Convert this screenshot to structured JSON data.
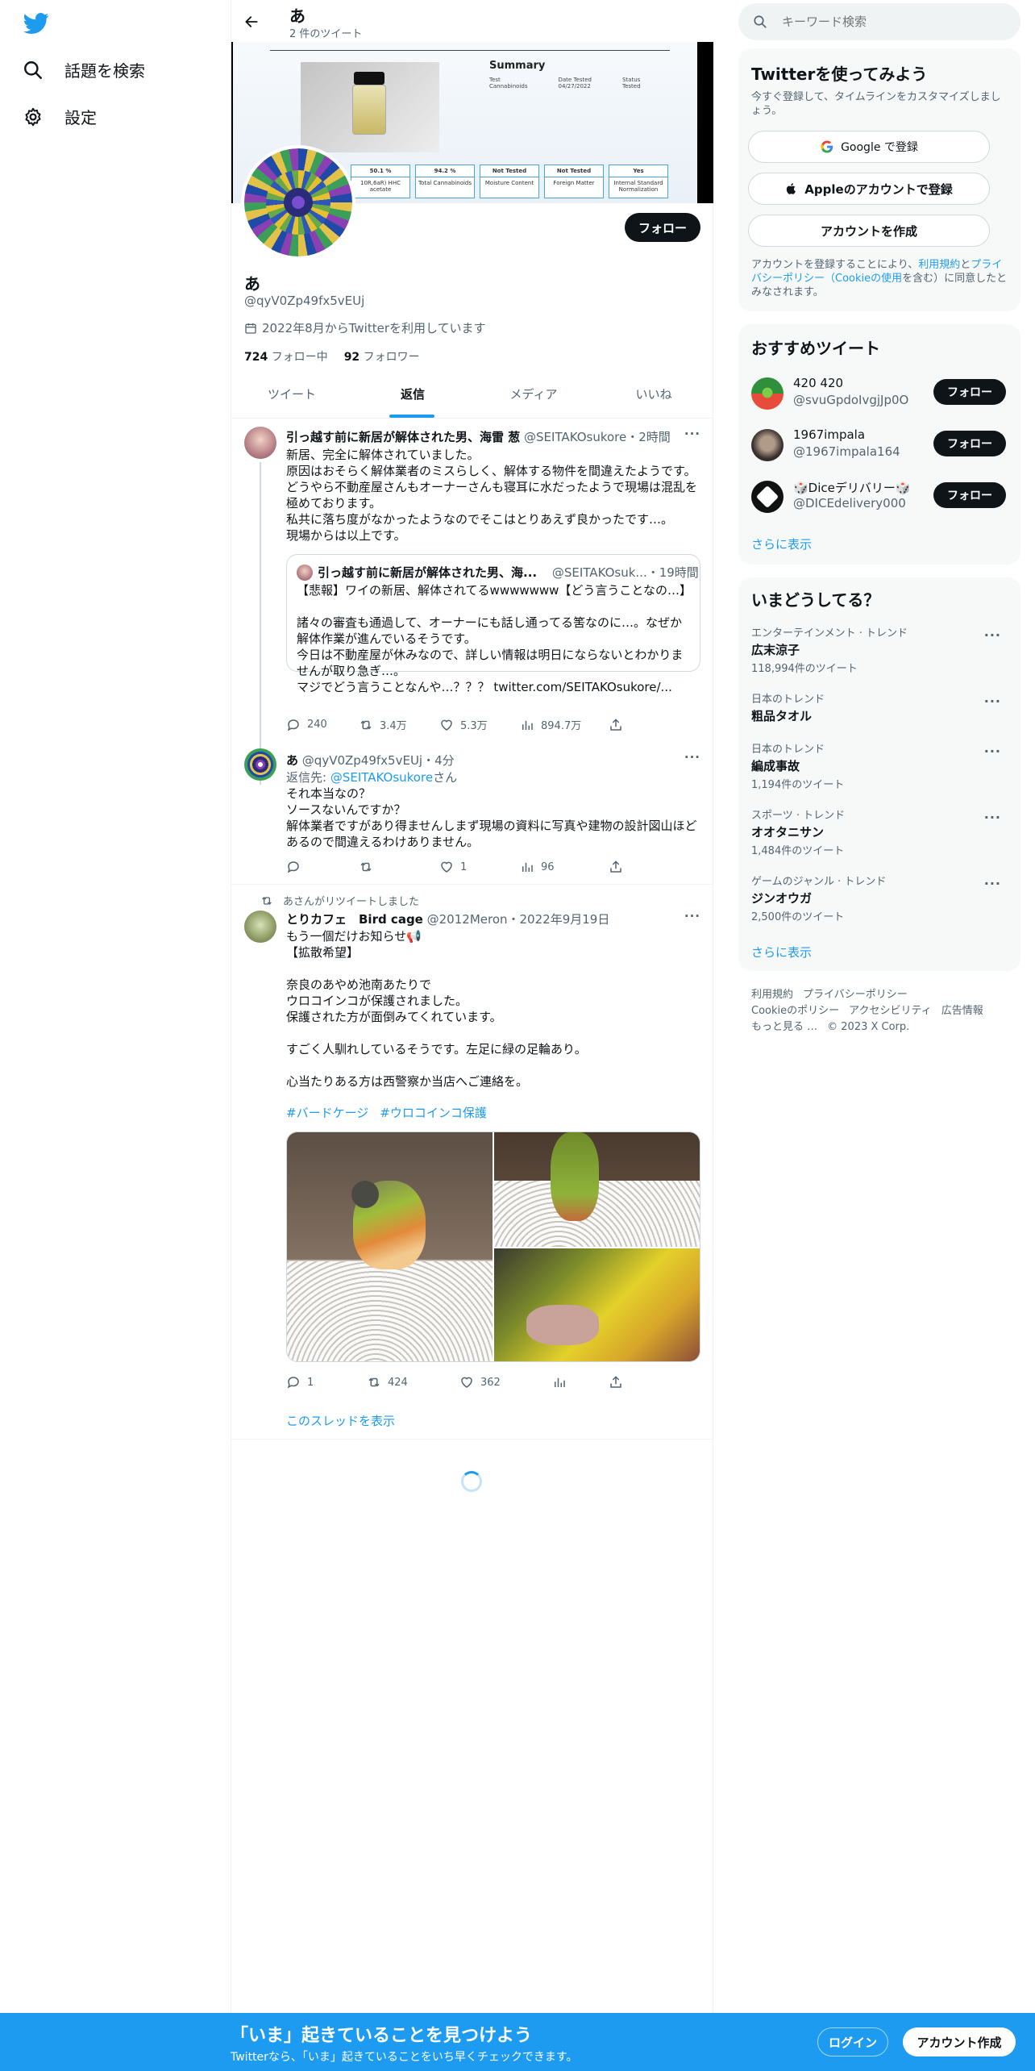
{
  "nav": {
    "explore_label": "話題を検索",
    "settings_label": "設定"
  },
  "header": {
    "title": "あ",
    "tweet_count": "2 件のツイート"
  },
  "banner": {
    "summary_title": "Summary",
    "summary_test_label": "Test",
    "summary_test_value": "Cannabinoids",
    "summary_date_label": "Date Tested",
    "summary_date_value": "04/27/2022",
    "summary_status_label": "Status",
    "summary_status_value": "Tested",
    "cells": [
      {
        "value": "50.1 %",
        "label": "10R,6aR) HHC acetate"
      },
      {
        "value": "94.2 %",
        "label": "Total Cannabinoids"
      },
      {
        "value": "Not Tested",
        "label": "Moisture Content"
      },
      {
        "value": "Not Tested",
        "label": "Foreign Matter"
      },
      {
        "value": "Yes",
        "label": "Internal Standard Normalization"
      }
    ]
  },
  "profile": {
    "name": "あ",
    "handle": "@qyV0Zp49fx5vEUj",
    "joined": "2022年8月からTwitterを利用しています",
    "following_count": "724",
    "following_label": "フォロー中",
    "followers_count": "92",
    "followers_label": "フォロワー",
    "follow_label": "フォロー"
  },
  "tabs": [
    "ツイート",
    "返信",
    "メディア",
    "いいね"
  ],
  "tweets": {
    "t1": {
      "author": "引っ越す前に新居が解体された男、海雷 葱",
      "handle": "@SEITAKOsukore",
      "time": "・2時間",
      "text": "新居、完全に解体されていました。\n原因はおそらく解体業者のミスらしく、解体する物件を間違えたようです。\nどうやら不動産屋さんもオーナーさんも寝耳に水だったようで現場は混乱を極めております。\n私共に落ち度がなかったようなのでそこはとりあえず良かったです…。\n現場からは以上です。",
      "quote": {
        "author": "引っ越す前に新居が解体された男、海...",
        "handle": "@SEITAKOsuk...",
        "time": "・19時間",
        "text": "【悲報】ワイの新居、解体されてるwwwwwww【どう言うことなの…】\n\n諸々の審査も通過して、オーナーにも話し通ってる筈なのに…。なぜか解体作業が進んでいるそうです。\n今日は不動産屋が休みなので、詳しい情報は明日にならないとわかりませんが取り急ぎ…。\nマジでどう言うことなんや…？？？ twitter.com/SEITAKOsukore/..."
      },
      "replies": "240",
      "retweets": "3.4万",
      "likes": "5.3万",
      "views": "894.7万"
    },
    "t2": {
      "author": "あ",
      "handle": "@qyV0Zp49fx5vEUj",
      "time": "・4分",
      "reply_to_prefix": "返信先: ",
      "reply_to_handle": "@SEITAKOsukore",
      "reply_to_suffix": "さん",
      "text": "それ本当なの？\nソースないんですか？\n解体業者ですがあり得ませんしまず現場の資料に写真や建物の設計図山ほどあるので間違えるわけありません。",
      "replies": "",
      "retweets": "",
      "likes": "1",
      "views": "96"
    },
    "t3": {
      "retweet_label": "あさんがリツイートしました",
      "author": "とりカフェ　Bird cage",
      "handle": "@2012Meron",
      "time": "・2022年9月19日",
      "text": "もう一個だけお知らせ📢\n【拡散希望】\n\n奈良のあやめ池南あたりで\nウロコインコが保護されました。\n保護された方が面倒みてくれています。\n\nすごく人馴れしているそうです。左足に緑の足輪あり。\n\n心当たりある方は西警察か当店へご連絡を。",
      "hashtags": [
        "#バードケージ",
        "#ウロコインコ保護"
      ],
      "replies": "1",
      "retweets": "424",
      "likes": "362",
      "views": "",
      "show_thread": "このスレッドを表示"
    }
  },
  "search": {
    "placeholder": "キーワード検索"
  },
  "signup": {
    "title": "Twitterを使ってみよう",
    "subtitle": "今すぐ登録して、タイムラインをカスタマイズしましょう。",
    "google_label": "Google で登録",
    "apple_label": "Appleのアカウントで登録",
    "create_label": "アカウントを作成",
    "terms_prefix": "アカウントを登録することにより、",
    "terms_link": "利用規約",
    "terms_mid": "と",
    "privacy_link": "プライバシーポリシー（Cookieの使用",
    "terms_suffix": "を含む）に同意したとみなされます。"
  },
  "recommend": {
    "title": "おすすめツイート",
    "users": [
      {
        "name": "420 420",
        "handle": "@svuGpdoIvgjJp0O",
        "follow": "フォロー"
      },
      {
        "name": "1967impala",
        "handle": "@1967impala164",
        "follow": "フォロー"
      },
      {
        "name": "🎲Diceデリバリー🎲",
        "handle": "@DICEdelivery000",
        "follow": "フォロー"
      }
    ],
    "more": "さらに表示"
  },
  "trends": {
    "title": "いまどうしてる？",
    "items": [
      {
        "category": "エンターテインメント · トレンド",
        "name": "広末涼子",
        "count": "118,994件のツイート"
      },
      {
        "category": "日本のトレンド",
        "name": "粗品タオル",
        "count": ""
      },
      {
        "category": "日本のトレンド",
        "name": "編成事故",
        "count": "1,194件のツイート"
      },
      {
        "category": "スポーツ · トレンド",
        "name": "オオタニサン",
        "count": "1,484件のツイート"
      },
      {
        "category": "ゲームのジャンル · トレンド",
        "name": "ジンオウガ",
        "count": "2,500件のツイート"
      }
    ],
    "more": "さらに表示"
  },
  "footer": {
    "terms": "利用規約",
    "privacy": "プライバシーポリシー",
    "cookie": "Cookieのポリシー",
    "accessibility": "アクセシビリティ",
    "ads": "広告情報",
    "more": "もっと見る …",
    "copyright": "© 2023 X Corp."
  },
  "bottom": {
    "title": "「いま」起きていることを見つけよう",
    "subtitle": "Twitterなら、「いま」起きていることをいち早くチェックできます。",
    "login": "ログイン",
    "signup": "アカウント作成"
  }
}
